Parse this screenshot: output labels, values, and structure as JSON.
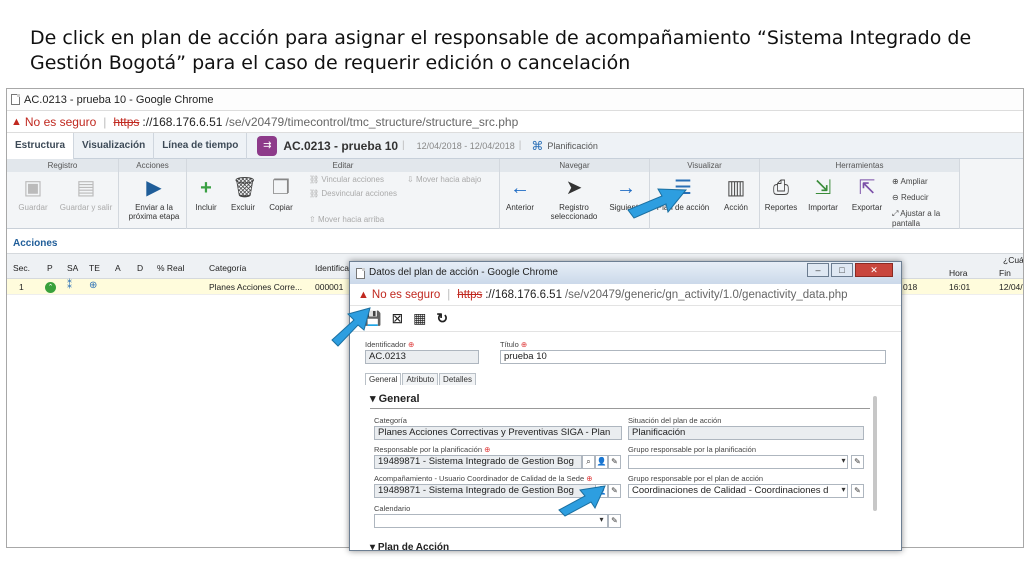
{
  "caption": {
    "line1": "De click en plan de acción para asignar el responsable de acompañamiento “Sistema Integrado de",
    "line2": "Gestión Bogotá” para el caso de requerir edición o cancelación"
  },
  "browser": {
    "title": "AC.0213 - prueba 10 - Google Chrome",
    "not_secure": "No es seguro",
    "protocol": "https",
    "host": "://168.176.6.51",
    "path": "/se/v20479/timecontrol/tmc_structure/structure_src.php"
  },
  "tabs": [
    "Estructura",
    "Visualización",
    "Línea de tiempo"
  ],
  "doc": {
    "badge": "⇉",
    "title": "AC.0213 - prueba 10",
    "dates": "12/04/2018 - 12/04/2018",
    "status": "Planificación"
  },
  "ribbon": {
    "groups": [
      "Registro",
      "Acciones",
      "Editar",
      "Navegar",
      "Visualizar",
      "Herramientas"
    ],
    "registro": [
      "Guardar",
      "Guardar y salir"
    ],
    "acciones": [
      "Enviar a la próxima etapa"
    ],
    "editar": [
      "Incluir",
      "Excluir",
      "Copiar"
    ],
    "editar_small": [
      "Vincular acciones",
      "Desvincular acciones",
      "Mover hacia arriba",
      "Mover hacia abajo"
    ],
    "navegar": [
      "Anterior",
      "Registro seleccionado",
      "Siguiente"
    ],
    "visualizar": [
      "Plan de acción",
      "Acción"
    ],
    "herramientas": [
      "Reportes",
      "Importar",
      "Exportar"
    ],
    "zoom": [
      "Ampliar",
      "Reducir",
      "Ajustar a la pantalla"
    ]
  },
  "section_title": "Acciones",
  "grid": {
    "headers": [
      "Sec.",
      "P",
      "SA",
      "TE",
      "A",
      "D",
      "% Real",
      "Categoría",
      "Identificador"
    ],
    "right_headers": [
      "Hora",
      "Fin",
      "¿Cuá"
    ],
    "row": {
      "sec": "1",
      "categoria": "Planes Acciones Corre...",
      "identificador": "000001",
      "date_tail": "018",
      "hora": "16:01",
      "fin": "12/04/"
    }
  },
  "popup": {
    "title": "Datos del plan de acción - Google Chrome",
    "not_secure": "No es seguro",
    "protocol": "https",
    "host": "://168.176.6.51",
    "path": "/se/v20479/generic/gn_activity/1.0/genactivity_data.php",
    "tabs": [
      "General",
      "Atributo",
      "Detalles"
    ],
    "section": "General",
    "next_section": "Plan de Acción",
    "fields": {
      "identificador_label": "Identificador",
      "identificador": "AC.0213",
      "titulo_label": "Título",
      "titulo": "prueba 10",
      "categoria_label": "Categoría",
      "categoria": "Planes Acciones Correctivas y Preventivas SIGA - Plan",
      "situacion_label": "Situación del plan de acción",
      "situacion": "Planificación",
      "resp_plan_label": "Responsable por la planificación",
      "resp_plan": "19489871 - Sistema Integrado de Gestion Bog",
      "grupo_plan_label": "Grupo responsable por la planificación",
      "grupo_plan": "",
      "acomp_label": "Acompañamiento - Usuario Coordinador de Calidad de la Sede",
      "acomp": "19489871 - Sistema Integrado de Gestion Bog",
      "grupo_resp_label": "Grupo responsable por el plan de acción",
      "grupo_resp": "Coordinaciones de Calidad - Coordinaciones d",
      "calendario_label": "Calendario",
      "calendario": ""
    }
  },
  "colors": {
    "arrow": "#2d9ee0",
    "badge": "#8d3b8a",
    "link": "#1f5d99"
  }
}
